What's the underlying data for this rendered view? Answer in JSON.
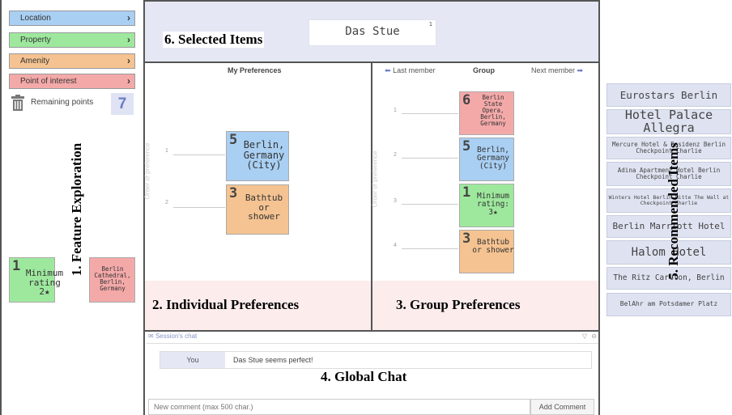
{
  "features": [
    {
      "label": "Location",
      "color": "#a9cff2"
    },
    {
      "label": "Property",
      "color": "#9ee89e"
    },
    {
      "label": "Amenity",
      "color": "#f5c391"
    },
    {
      "label": "Point of interest",
      "color": "#f4a9a9"
    }
  ],
  "remaining": {
    "label": "Remaining points",
    "value": "7"
  },
  "left_cards": {
    "minimum": {
      "num": "1",
      "text": "Minimum rating 2★"
    },
    "cathedral": {
      "text": "Berlin Cathedral, Berlin, Germany"
    }
  },
  "selected": {
    "item": "Das Stue",
    "badge": "1"
  },
  "my_prefs": {
    "title": "My Preferences",
    "axis": "Order of preference",
    "rows": [
      "1",
      "2"
    ],
    "cards": [
      {
        "num": "5",
        "text": "Berlin, Germany (City)"
      },
      {
        "num": "3",
        "text": "Bathtub or shower"
      }
    ]
  },
  "group": {
    "prev": "Last member",
    "title": "Group",
    "next": "Next member",
    "axis": "Order of preference",
    "rows": [
      "1",
      "2",
      "3",
      "4"
    ],
    "cards": [
      {
        "num": "6",
        "text": "Berlin State Opera, Berlin, Germany"
      },
      {
        "num": "5",
        "text": "Berlin, Germany (City)"
      },
      {
        "num": "1",
        "text": "Minimum rating: 3★"
      },
      {
        "num": "3",
        "text": "Bathtub or shower"
      }
    ]
  },
  "chat": {
    "header": "Session's chat",
    "messages": [
      {
        "author": "You",
        "text": "Das Stue seems perfect!"
      }
    ],
    "placeholder": "New comment (max 500 char.)",
    "button": "Add Comment"
  },
  "recommended": [
    "Eurostars Berlin",
    "Hotel Palace Allegra",
    "Mercure Hotel & Residenz Berlin Checkpoint Charlie",
    "Adina Apartment Hotel Berlin Checkpoint Charlie",
    "Winters Hotel Berlin Mitte The Wall at Checkpoint Charlie",
    "Berlin Marriott Hotel",
    "Halom Hotel",
    "The Ritz Carlton, Berlin",
    "BelAhr am Potsdamer Platz"
  ],
  "overlay_labels": {
    "feature": "1. Feature Exploration",
    "individual": "2. Individual Preferences",
    "group": "3. Group Preferences",
    "chat": "4. Global Chat",
    "recommended": "5. Recommended Items",
    "selected": "6. Selected Items"
  }
}
